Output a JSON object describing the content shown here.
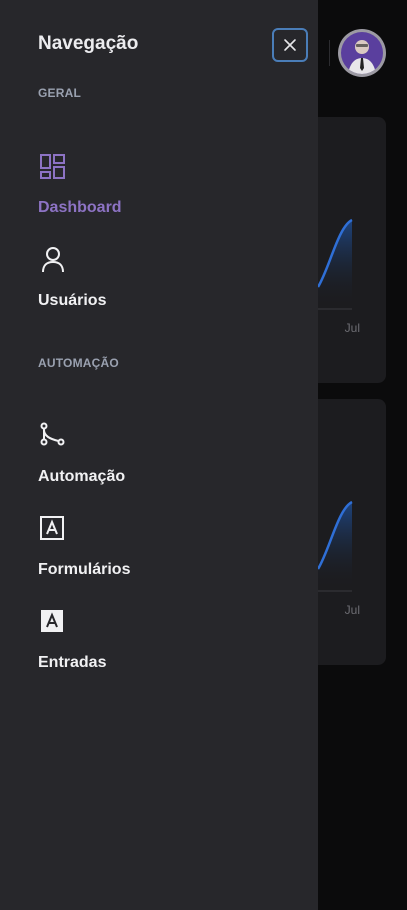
{
  "drawer": {
    "title": "Navegação",
    "close_icon": "close-icon",
    "sections": [
      {
        "label": "GERAL",
        "items": [
          {
            "label": "Dashboard",
            "icon": "dashboard-icon",
            "active": true
          },
          {
            "label": "Usuários",
            "icon": "user-icon",
            "active": false
          }
        ]
      },
      {
        "label": "AUTOMAÇÃO",
        "items": [
          {
            "label": "Automação",
            "icon": "workflow-icon",
            "active": false
          },
          {
            "label": "Formulários",
            "icon": "form-outline-icon",
            "active": false
          },
          {
            "label": "Entradas",
            "icon": "form-filled-icon",
            "active": false
          }
        ]
      }
    ]
  },
  "background": {
    "cards": [
      {
        "axis_label": "Jul"
      },
      {
        "axis_label": "Jul"
      }
    ]
  },
  "header": {
    "avatar": "user-avatar"
  },
  "colors": {
    "drawer_bg": "#27272b",
    "active": "#8d73c4",
    "close_border": "#4a7db8",
    "chart_line": "#2f6fd6"
  }
}
